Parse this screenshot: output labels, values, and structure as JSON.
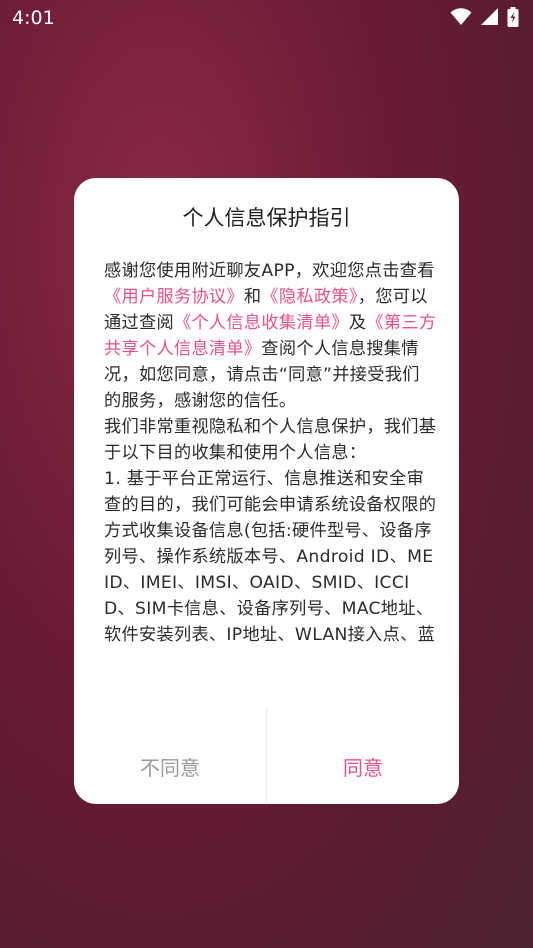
{
  "status_bar": {
    "time": "4:01",
    "icons": [
      "wifi-icon",
      "signal-icon",
      "battery-charging-icon"
    ]
  },
  "colors": {
    "accent": "#e8528a",
    "background": "#6a1a35",
    "dialog": "#ffffff",
    "muted_text": "#9a9a9a"
  },
  "dialog": {
    "title": "个人信息保护指引",
    "body": {
      "p1_a": "感谢您使用附近聊友APP，欢迎您点击查看",
      "link_user_agreement": "《用户服务协议》",
      "p1_and": "和",
      "link_privacy_policy": "《隐私政策》",
      "p1_b": "，您可以通过查阅",
      "link_personal_info_list": "《个人信息收集清单》",
      "p1_ji": "及",
      "link_third_party_list": "《第三方共享个人信息清单》",
      "p1_c": "查阅个人信息搜集情况，如您同意，请点击“同意”并接受我们的服务，感谢您的信任。",
      "p2": "我们非常重视隐私和个人信息保护，我们基于以下目的收集和使用个人信息：",
      "p3": "1. 基于平台正常运行、信息推送和安全审查的目的，我们可能会申请系统设备权限的方式收集设备信息(包括:硬件型号、设备序列号、操作系统版本号、Android ID、MEID、IMEI、IMSI、OAID、SMID、ICCID、SIM卡信息、设备序列号、MAC地址、软件安装列表、IP地址、WLAN接入点、蓝"
    },
    "disagree_label": "不同意",
    "agree_label": "同意"
  }
}
